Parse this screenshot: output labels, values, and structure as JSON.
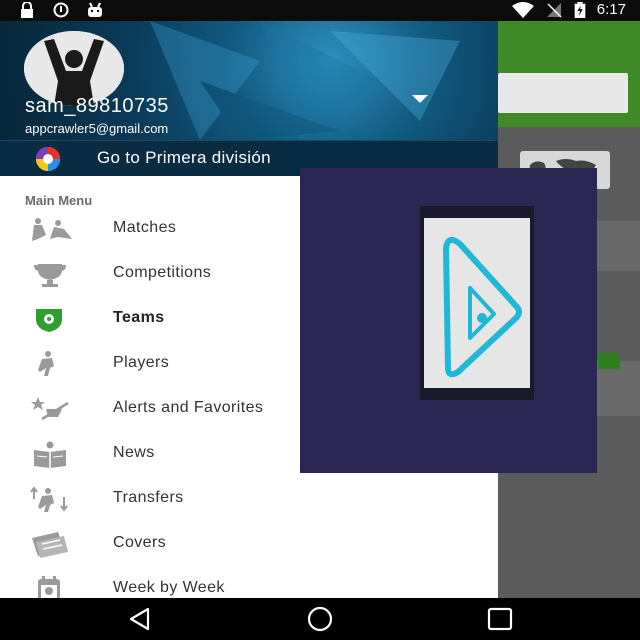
{
  "status_bar": {
    "time": "6:17",
    "left_icons": [
      "lock-icon",
      "sync-icon",
      "android-icon"
    ],
    "right_icons": [
      "wifi-icon",
      "no-signal-icon",
      "battery-charging-icon"
    ]
  },
  "drawer": {
    "header": {
      "username": "sam_89810735",
      "email": "appcrawler5@gmail.com",
      "league_link": "Go to Primera división"
    },
    "menu_title": "Main Menu",
    "items": [
      {
        "label": "Matches",
        "icon": "players-tackle-icon",
        "active": false
      },
      {
        "label": "Competitions",
        "icon": "trophy-icon",
        "active": false
      },
      {
        "label": "Teams",
        "icon": "shield-icon",
        "active": true
      },
      {
        "label": "Players",
        "icon": "player-icon",
        "active": false
      },
      {
        "label": "Alerts and Favorites",
        "icon": "alerts-icon",
        "active": false
      },
      {
        "label": "News",
        "icon": "news-icon",
        "active": false
      },
      {
        "label": "Transfers",
        "icon": "transfers-icon",
        "active": false
      },
      {
        "label": "Covers",
        "icon": "covers-icon",
        "active": false
      },
      {
        "label": "Week by Week",
        "icon": "calendar-icon",
        "active": false
      }
    ]
  },
  "colors": {
    "app_green": "#3f8a26",
    "drawer_header": "#0b3a58",
    "active_icon": "#2e9e2e",
    "overlay_bg": "#2a2752",
    "overlay_accent": "#1fb8d6"
  },
  "navigation_bar": {
    "buttons": [
      "back-icon",
      "home-icon",
      "recents-icon"
    ]
  }
}
